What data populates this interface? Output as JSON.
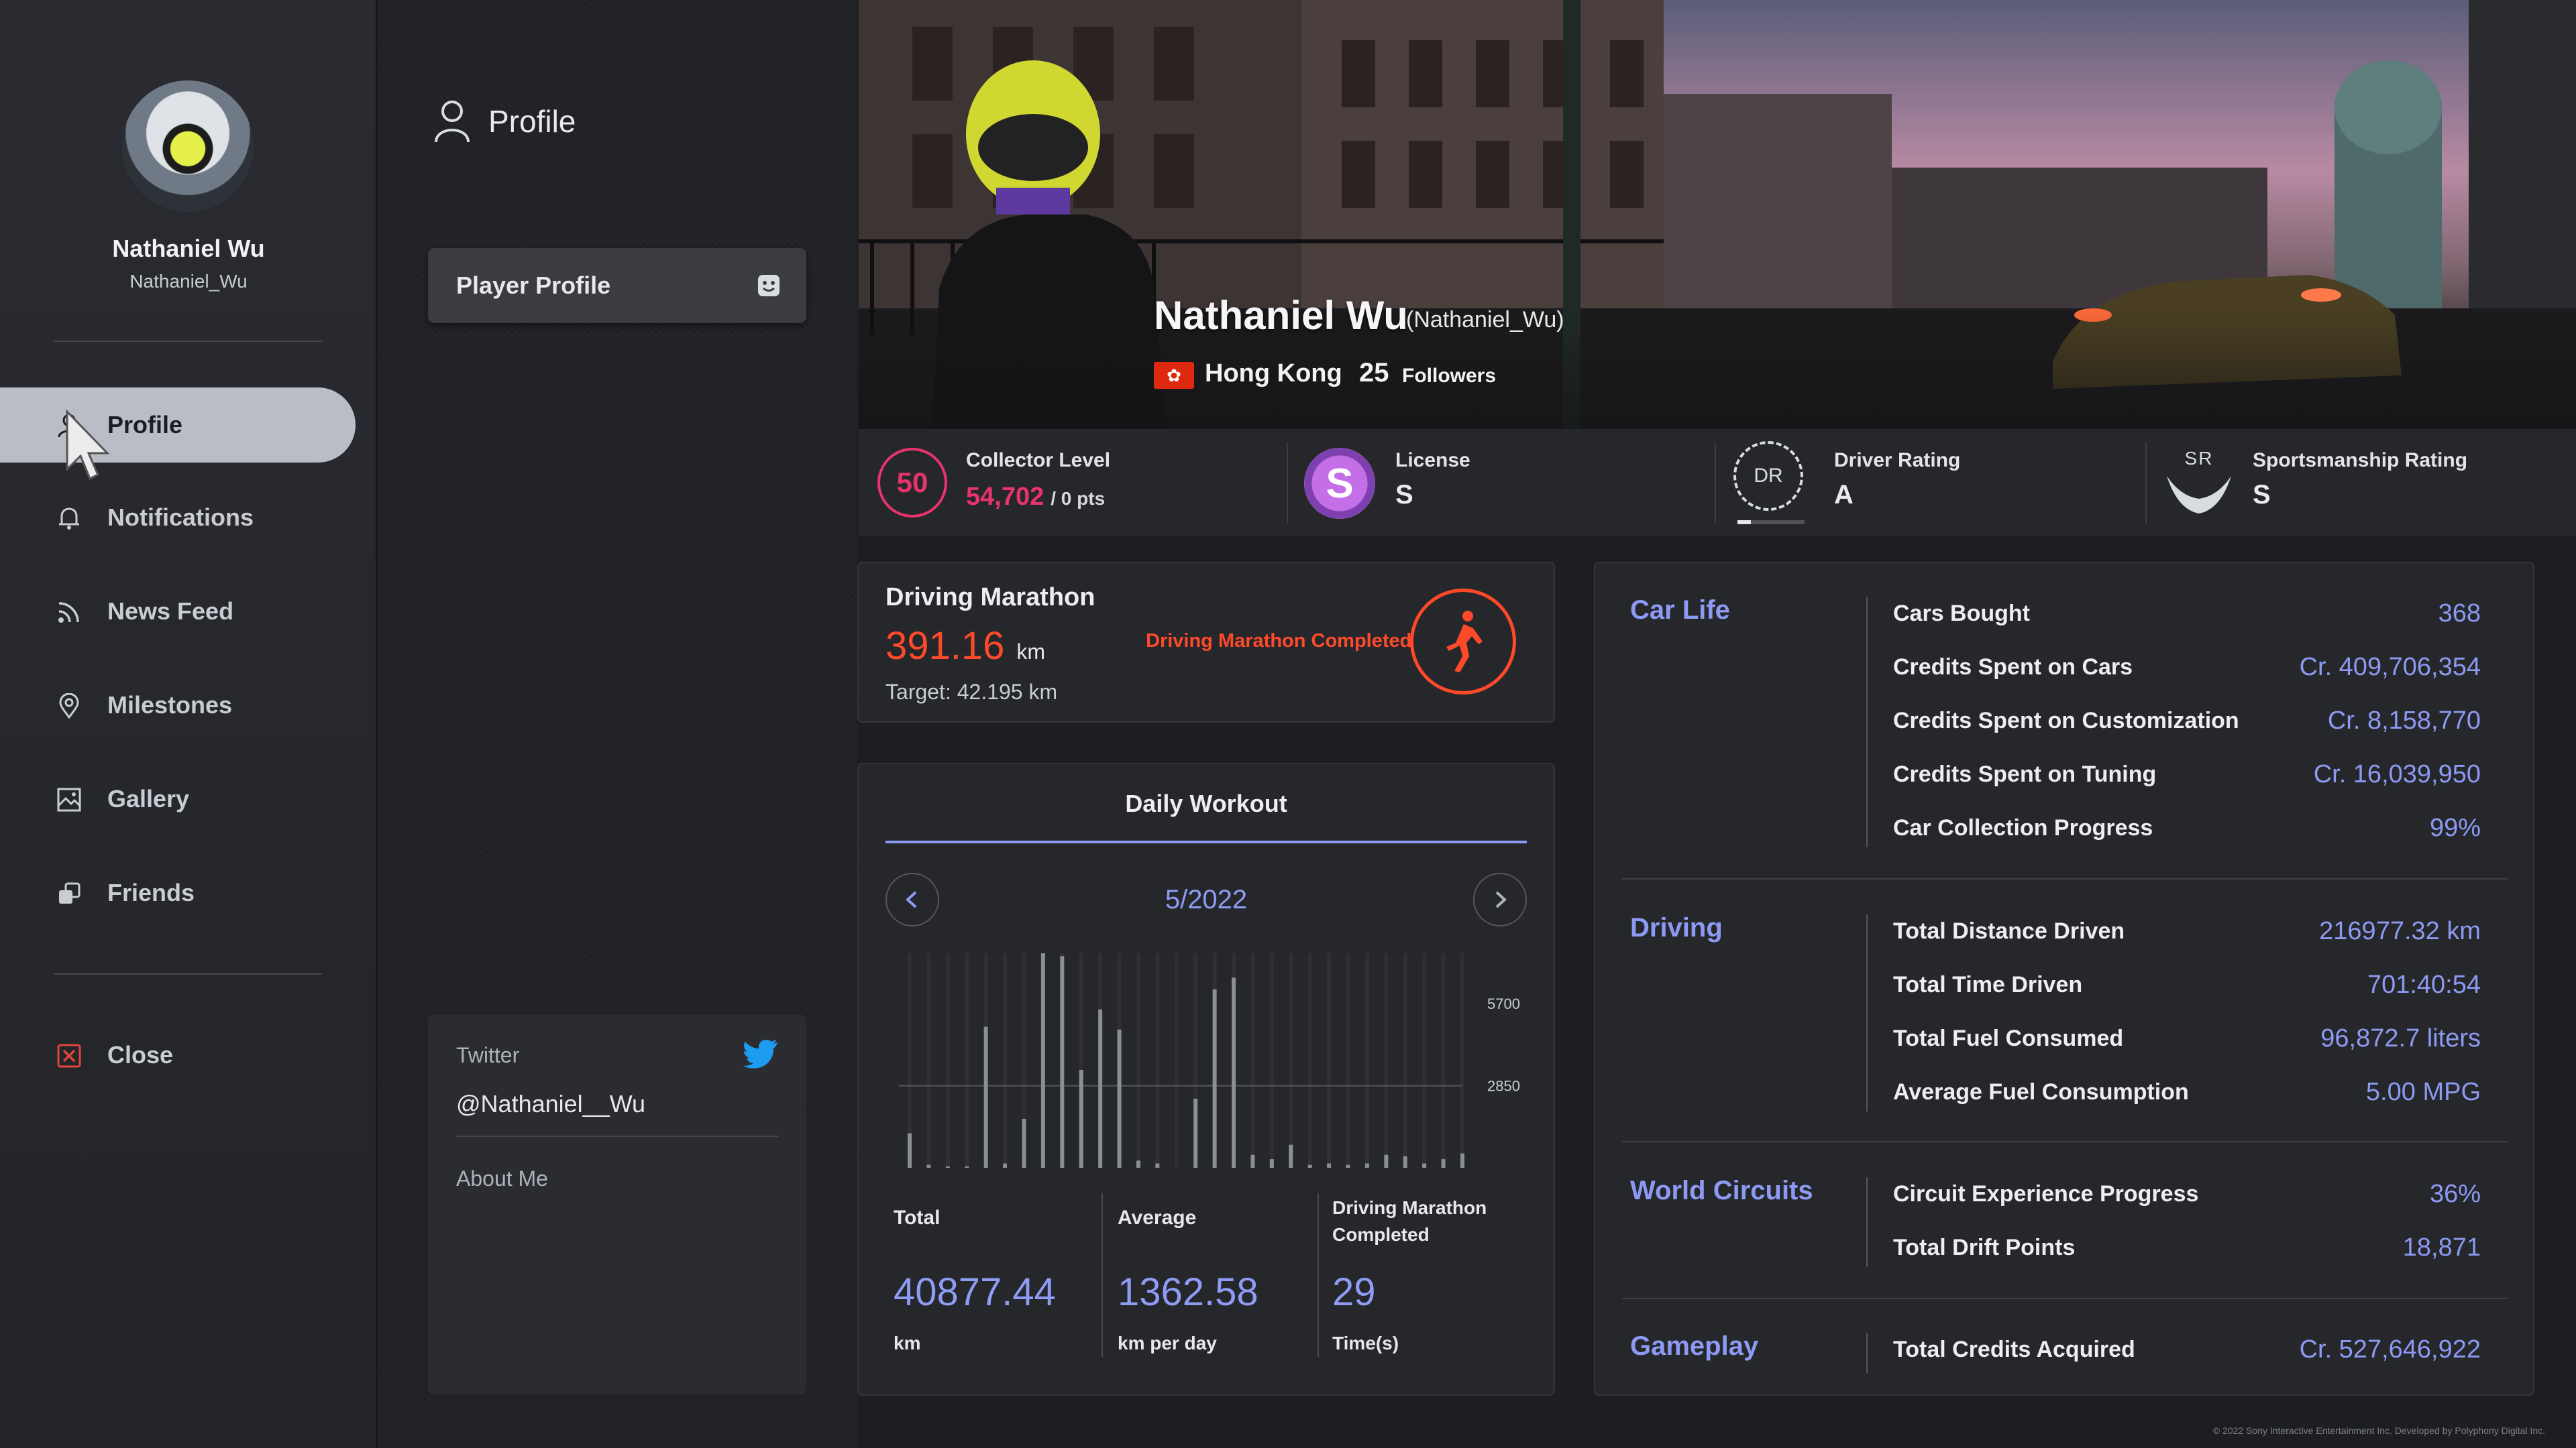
{
  "user": {
    "display_name": "Nathaniel Wu",
    "username": "Nathaniel_Wu",
    "username_paren": "(Nathaniel_Wu)",
    "country": "Hong Kong",
    "followers_count": "25",
    "followers_label": "Followers"
  },
  "nav": {
    "items": [
      {
        "label": "Profile",
        "icon": "person-icon",
        "active": true
      },
      {
        "label": "Notifications",
        "icon": "bell-icon"
      },
      {
        "label": "News Feed",
        "icon": "rss-icon"
      },
      {
        "label": "Milestones",
        "icon": "location-pin-icon"
      },
      {
        "label": "Gallery",
        "icon": "gallery-icon"
      },
      {
        "label": "Friends",
        "icon": "friends-icon"
      }
    ],
    "close_label": "Close"
  },
  "middle": {
    "header": "Profile",
    "player_profile_button": "Player Profile",
    "twitter_label": "Twitter",
    "twitter_handle": "@Nathaniel__Wu",
    "about_label": "About Me"
  },
  "ratings": {
    "collector": {
      "badge": "50",
      "title": "Collector Level",
      "points": "54,702",
      "total": "/ 0 pts"
    },
    "license": {
      "badge": "S",
      "title": "License",
      "value": "S"
    },
    "driver": {
      "badge": "DR",
      "title": "Driver Rating",
      "value": "A"
    },
    "sportsmanship": {
      "badge": "SR",
      "title": "Sportsmanship Rating",
      "value": "S"
    }
  },
  "marathon": {
    "title": "Driving Marathon",
    "distance": "391.16",
    "unit": "km",
    "target": "Target: 42.195 km",
    "status": "Driving Marathon Completed"
  },
  "workout": {
    "title": "Daily Workout",
    "month": "5/2022",
    "totals": [
      {
        "label": "Total",
        "value": "40877.44",
        "unit": "km"
      },
      {
        "label": "Average",
        "value": "1362.58",
        "unit": "km per day"
      },
      {
        "label": "Driving Marathon Completed",
        "value": "29",
        "unit": "Time(s)"
      }
    ]
  },
  "chart_data": {
    "type": "bar",
    "yticks": [
      "5700",
      "2850"
    ],
    "ylim": [
      0,
      7450
    ],
    "values": [
      1200,
      100,
      50,
      50,
      4900,
      150,
      1700,
      7450,
      7350,
      3400,
      5500,
      4800,
      250,
      150,
      0,
      2400,
      6200,
      6600,
      450,
      300,
      800,
      100,
      150,
      100,
      150,
      450,
      400,
      150,
      300,
      500
    ],
    "grid": true
  },
  "stats": {
    "sections": [
      {
        "title": "Car Life",
        "rows": [
          {
            "label": "Cars Bought",
            "value": "368"
          },
          {
            "label": "Credits Spent on Cars",
            "value": "Cr. 409,706,354"
          },
          {
            "label": "Credits Spent on Customization",
            "value": "Cr. 8,158,770"
          },
          {
            "label": "Credits Spent on Tuning",
            "value": "Cr. 16,039,950"
          },
          {
            "label": "Car Collection Progress",
            "value": "99%"
          }
        ]
      },
      {
        "title": "Driving",
        "rows": [
          {
            "label": "Total Distance Driven",
            "value": "216977.32 km"
          },
          {
            "label": "Total Time Driven",
            "value": "701:40:54"
          },
          {
            "label": "Total Fuel Consumed",
            "value": "96,872.7 liters"
          },
          {
            "label": "Average Fuel Consumption",
            "value": "5.00 MPG"
          }
        ]
      },
      {
        "title": "World Circuits",
        "rows": [
          {
            "label": "Circuit Experience Progress",
            "value": "36%"
          },
          {
            "label": "Total Drift Points",
            "value": "18,871"
          }
        ]
      },
      {
        "title": "Gameplay",
        "rows": [
          {
            "label": "Total Credits Acquired",
            "value": "Cr. 527,646,922"
          }
        ]
      }
    ]
  },
  "colors": {
    "accent_blue": "#8c9af3",
    "accent_red": "#ff4a2a",
    "collector_pink": "#e8336d",
    "twitter_blue": "#1d9bf0"
  },
  "copyright": "© 2022 Sony Interactive Entertainment Inc. Developed by Polyphony Digital Inc."
}
